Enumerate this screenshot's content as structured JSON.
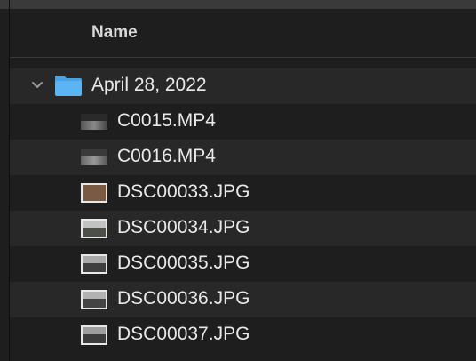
{
  "header": {
    "name_column": "Name"
  },
  "folder": {
    "name": "April 28, 2022",
    "expanded": true,
    "icon": "folder-icon",
    "color": "#5bb5f2"
  },
  "files": [
    {
      "name": "C0015.MP4",
      "kind": "video",
      "icon": "video-thumbnail-icon"
    },
    {
      "name": "C0016.MP4",
      "kind": "video",
      "icon": "video-thumbnail-icon"
    },
    {
      "name": "DSC00033.JPG",
      "kind": "image",
      "icon": "image-thumbnail-icon"
    },
    {
      "name": "DSC00034.JPG",
      "kind": "image",
      "icon": "image-thumbnail-icon"
    },
    {
      "name": "DSC00035.JPG",
      "kind": "image",
      "icon": "image-thumbnail-icon"
    },
    {
      "name": "DSC00036.JPG",
      "kind": "image",
      "icon": "image-thumbnail-icon"
    },
    {
      "name": "DSC00037.JPG",
      "kind": "image",
      "icon": "image-thumbnail-icon"
    }
  ]
}
